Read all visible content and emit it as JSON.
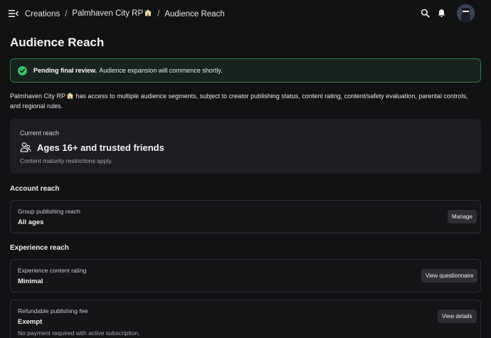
{
  "breadcrumb": {
    "items": [
      "Creations",
      "Palmhaven City RP",
      "Audience Reach"
    ],
    "separator": "/"
  },
  "page": {
    "title": "Audience Reach"
  },
  "banner": {
    "strong": "Pending final review.",
    "text": "Audience expansion will commence shortly.",
    "color": "#2f7a4c"
  },
  "intro": {
    "experience_name": "Palmhaven City RP",
    "text": "has access to multiple audience segments, subject to creator publishing status, content rating, content/safety evaluation, parental controls, and regional rules."
  },
  "current_reach": {
    "label": "Current reach",
    "value": "Ages 16+ and trusted friends",
    "note": "Content maturity restrictions apply."
  },
  "account_reach": {
    "section_title": "Account reach",
    "rows": [
      {
        "label": "Group publishing reach",
        "value": "All ages",
        "button": "Manage"
      }
    ]
  },
  "experience_reach": {
    "section_title": "Experience reach",
    "rows": [
      {
        "label": "Experience content rating",
        "value": "Minimal",
        "button": "View questionnaire"
      },
      {
        "label": "Refundable publishing fee",
        "value": "Exempt",
        "sub": "No payment required with active subscription.",
        "button": "View details"
      }
    ]
  },
  "icons": {
    "menu": "menu-collapse-icon",
    "search": "search-icon",
    "notifications": "bell-icon",
    "status": "check-circle-icon",
    "audience": "people-icon",
    "house": "house-with-palm-emoji"
  }
}
